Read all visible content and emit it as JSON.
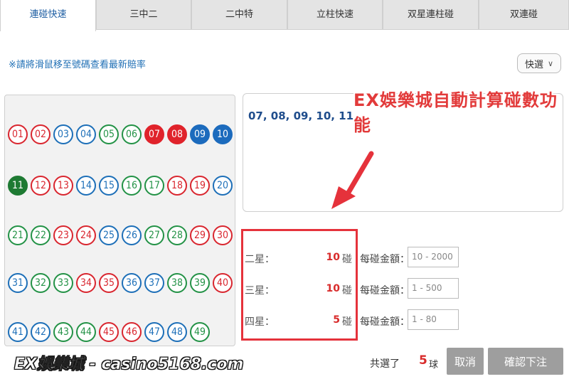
{
  "tabs": [
    {
      "label": "連碰快速",
      "active": true
    },
    {
      "label": "三中二",
      "active": false
    },
    {
      "label": "二中特",
      "active": false
    },
    {
      "label": "立柱快速",
      "active": false
    },
    {
      "label": "双星連柱碰",
      "active": false
    },
    {
      "label": "双連碰",
      "active": false
    }
  ],
  "tip": "※請將滑鼠移至號碼查看最新賠率",
  "quick_select": {
    "label": "快選"
  },
  "balls": [
    {
      "n": "01",
      "c": "red"
    },
    {
      "n": "02",
      "c": "red"
    },
    {
      "n": "03",
      "c": "blue"
    },
    {
      "n": "04",
      "c": "blue"
    },
    {
      "n": "05",
      "c": "green"
    },
    {
      "n": "06",
      "c": "green"
    },
    {
      "n": "07",
      "c": "red",
      "sel": true
    },
    {
      "n": "08",
      "c": "red",
      "sel": true
    },
    {
      "n": "09",
      "c": "blue",
      "sel": true
    },
    {
      "n": "10",
      "c": "blue",
      "sel": true
    },
    {
      "n": "11",
      "c": "green",
      "sel": true
    },
    {
      "n": "12",
      "c": "red"
    },
    {
      "n": "13",
      "c": "red"
    },
    {
      "n": "14",
      "c": "blue"
    },
    {
      "n": "15",
      "c": "blue"
    },
    {
      "n": "16",
      "c": "green"
    },
    {
      "n": "17",
      "c": "green"
    },
    {
      "n": "18",
      "c": "red"
    },
    {
      "n": "19",
      "c": "red"
    },
    {
      "n": "20",
      "c": "blue"
    },
    {
      "n": "21",
      "c": "green"
    },
    {
      "n": "22",
      "c": "green"
    },
    {
      "n": "23",
      "c": "red"
    },
    {
      "n": "24",
      "c": "red"
    },
    {
      "n": "25",
      "c": "blue"
    },
    {
      "n": "26",
      "c": "blue"
    },
    {
      "n": "27",
      "c": "green"
    },
    {
      "n": "28",
      "c": "green"
    },
    {
      "n": "29",
      "c": "red"
    },
    {
      "n": "30",
      "c": "red"
    },
    {
      "n": "31",
      "c": "blue"
    },
    {
      "n": "32",
      "c": "green"
    },
    {
      "n": "33",
      "c": "green"
    },
    {
      "n": "34",
      "c": "red"
    },
    {
      "n": "35",
      "c": "red"
    },
    {
      "n": "36",
      "c": "blue"
    },
    {
      "n": "37",
      "c": "blue"
    },
    {
      "n": "38",
      "c": "green"
    },
    {
      "n": "39",
      "c": "green"
    },
    {
      "n": "40",
      "c": "red"
    },
    {
      "n": "41",
      "c": "blue"
    },
    {
      "n": "42",
      "c": "blue"
    },
    {
      "n": "43",
      "c": "green"
    },
    {
      "n": "44",
      "c": "green"
    },
    {
      "n": "45",
      "c": "red"
    },
    {
      "n": "46",
      "c": "red"
    },
    {
      "n": "47",
      "c": "blue"
    },
    {
      "n": "48",
      "c": "blue"
    },
    {
      "n": "49",
      "c": "green"
    }
  ],
  "selected_numbers": "07, 08, 09, 10, 11",
  "banner": "EX娛樂城自動計算碰數功能",
  "bet_rows": [
    {
      "label": "二星：",
      "count": "10",
      "unit": "碰",
      "amount_label": "每碰金額：",
      "range": "10 - 2000"
    },
    {
      "label": "三星：",
      "count": "10",
      "unit": "碰",
      "amount_label": "每碰金額：",
      "range": "1 - 500"
    },
    {
      "label": "四星：",
      "count": "5",
      "unit": "碰",
      "amount_label": "每碰金額：",
      "range": "1 - 80"
    }
  ],
  "footer": {
    "total_label": "共選了",
    "total_count": "5",
    "total_unit": "球",
    "cancel": "取消",
    "confirm": "確認下注"
  },
  "watermark": "EX娛樂城 - casino5168.com",
  "colors": {
    "red": "#d9262f",
    "blue": "#1d6fb8",
    "green": "#239246",
    "accent": "#e5323b"
  }
}
